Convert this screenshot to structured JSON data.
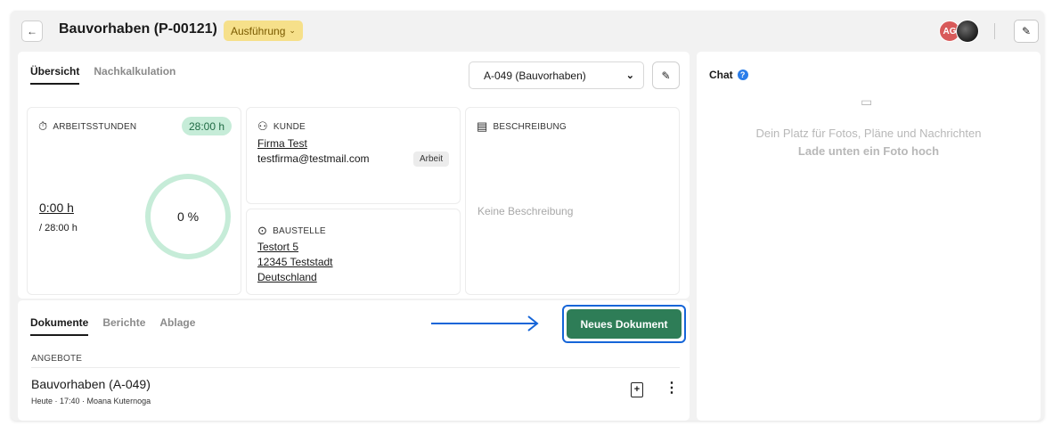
{
  "header": {
    "back_icon": "arrow-left-icon",
    "title": "Bauvorhaben (P-00121)",
    "status": "Ausführung",
    "avatar_initials": "AG",
    "edit_icon": "pencil-icon"
  },
  "overview": {
    "tabs": [
      "Übersicht",
      "Nachkalkulation"
    ],
    "active_tab": "Übersicht",
    "selected_offer": "A-049 (Bauvorhaben)"
  },
  "hours": {
    "label": "ARBEITSSTUNDEN",
    "budget_pill": "28:00 h",
    "current": "0:00 h",
    "total": "/ 28:00 h",
    "percent_text": "0 %",
    "progress": 0
  },
  "customer": {
    "label": "KUNDE",
    "name": "Firma Test",
    "email": "testfirma@testmail.com",
    "tag": "Arbeit"
  },
  "site": {
    "label": "BAUSTELLE",
    "street": "Testort 5",
    "city": "12345 Teststadt",
    "country": "Deutschland"
  },
  "description": {
    "label": "BESCHREIBUNG",
    "empty_text": "Keine Beschreibung"
  },
  "documents": {
    "tabs": [
      "Dokumente",
      "Berichte",
      "Ablage"
    ],
    "active_tab": "Dokumente",
    "new_button": "Neues Dokument",
    "section_label": "ANGEBOTE",
    "items": [
      {
        "title": "Bauvorhaben (A-049)",
        "meta": "Heute · 17:40 · Moana Kuternoga"
      }
    ]
  },
  "chat": {
    "title": "Chat",
    "empty_line1": "Dein Platz für Fotos, Pläne und Nachrichten",
    "empty_line2": "Lade unten ein Foto hoch"
  },
  "colors": {
    "status_badge": "#f6e08a",
    "accent_green": "#2e7d57",
    "highlight_blue": "#1565d8",
    "progress_ring": "#c6ecd8"
  }
}
